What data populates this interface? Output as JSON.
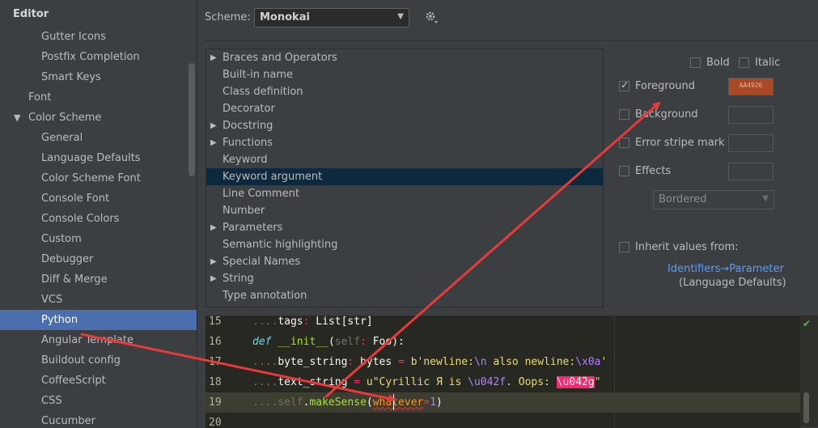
{
  "sidebar": {
    "section_title": "Editor",
    "items": [
      {
        "label": "Gutter Icons"
      },
      {
        "label": "Postfix Completion"
      },
      {
        "label": "Smart Keys"
      },
      {
        "label": "Font"
      },
      {
        "label": "Color Scheme",
        "expanded": true
      },
      {
        "label": "General"
      },
      {
        "label": "Language Defaults"
      },
      {
        "label": "Color Scheme Font"
      },
      {
        "label": "Console Font"
      },
      {
        "label": "Console Colors"
      },
      {
        "label": "Custom"
      },
      {
        "label": "Debugger"
      },
      {
        "label": "Diff & Merge"
      },
      {
        "label": "VCS"
      },
      {
        "label": "Python",
        "selected": true
      },
      {
        "label": "Angular Template"
      },
      {
        "label": "Buildout config"
      },
      {
        "label": "CoffeeScript"
      },
      {
        "label": "CSS"
      },
      {
        "label": "Cucumber"
      }
    ]
  },
  "scheme": {
    "label": "Scheme:",
    "value": "Monokai",
    "settings_icon": "gear-icon"
  },
  "attributes_tree": {
    "items": [
      {
        "label": "Braces and Operators",
        "expandable": true
      },
      {
        "label": "Built-in name",
        "expandable": false
      },
      {
        "label": "Class definition",
        "expandable": false
      },
      {
        "label": "Decorator",
        "expandable": false
      },
      {
        "label": "Docstring",
        "expandable": true
      },
      {
        "label": "Functions",
        "expandable": true
      },
      {
        "label": "Keyword",
        "expandable": false
      },
      {
        "label": "Keyword argument",
        "expandable": false,
        "selected": true
      },
      {
        "label": "Line Comment",
        "expandable": false
      },
      {
        "label": "Number",
        "expandable": false
      },
      {
        "label": "Parameters",
        "expandable": true
      },
      {
        "label": "Semantic highlighting",
        "expandable": false
      },
      {
        "label": "Special Names",
        "expandable": true
      },
      {
        "label": "String",
        "expandable": true
      },
      {
        "label": "Type annotation",
        "expandable": false
      }
    ]
  },
  "options": {
    "bold_label": "Bold",
    "italic_label": "Italic",
    "foreground_label": "Foreground",
    "foreground_checked": true,
    "foreground_value": "AA4926",
    "foreground_color": "#AA4926",
    "background_label": "Background",
    "error_stripe_label": "Error stripe mark",
    "effects_label": "Effects",
    "effects_type": "Bordered",
    "inherit_label": "Inherit values from:",
    "inherit_link": "Identifiers→Parameter",
    "inherit_source": "(Language Defaults)"
  },
  "editor": {
    "lines": [
      {
        "number": "15",
        "text": "tags: List[str]"
      },
      {
        "number": "16",
        "text": "def __init__(self: Foo):"
      },
      {
        "number": "17",
        "text": "byte_string: bytes = b'newline:\\n also newline:\\x0a'"
      },
      {
        "number": "18",
        "text": "text_string = u\"Cyrillic Я is \\u042f. Oops: \\u042g\""
      },
      {
        "number": "19",
        "text": "self.makeSense(whatever=1)"
      },
      {
        "number": "20",
        "text": ""
      }
    ],
    "current_line": "19"
  },
  "colors": {
    "sidebar_selected": "#4B6EAF",
    "tree_selected": "#0D293E",
    "editor_background": "#272822",
    "annotation_arrow": "#E83A3A"
  }
}
